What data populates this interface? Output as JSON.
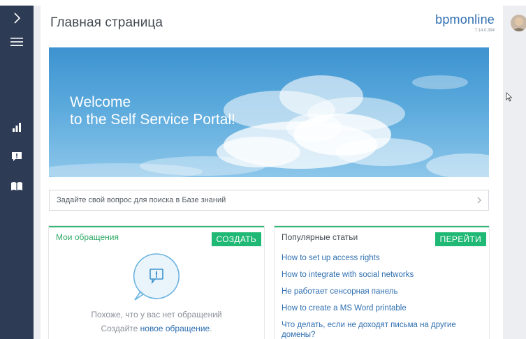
{
  "header": {
    "title": "Главная страница",
    "brand": "bpmonline",
    "version": "7.14.0.394"
  },
  "banner": {
    "line1": "Welcome",
    "line2": "to the Self Service Portal!"
  },
  "search": {
    "placeholder": "Задайте свой вопрос для поиска в Базе знаний"
  },
  "my_requests": {
    "title": "Мои обращения",
    "create_label": "СОЗДАТЬ",
    "empty_message": "Похоже, что у вас нет обращений",
    "create_prompt": "Создайте ",
    "create_link": "новое обращение",
    "create_suffix": "."
  },
  "popular": {
    "title": "Популярные статьи",
    "go_label": "ПЕРЕЙТИ",
    "articles": [
      "How to set up access rights",
      "How to integrate with social networks",
      "Не работает сенсорная панель",
      "How to create a MS Word printable",
      "Что делать, если не доходят письма на другие домены?"
    ]
  },
  "sidebar": {
    "icons": [
      "chevron-right-icon",
      "menu-icon",
      "dashboard-icon",
      "cases-icon",
      "knowledge-base-icon"
    ]
  },
  "colors": {
    "sidebar": "#2e3b55",
    "accent_green": "#1fb874",
    "link_blue": "#2f6fb0"
  }
}
